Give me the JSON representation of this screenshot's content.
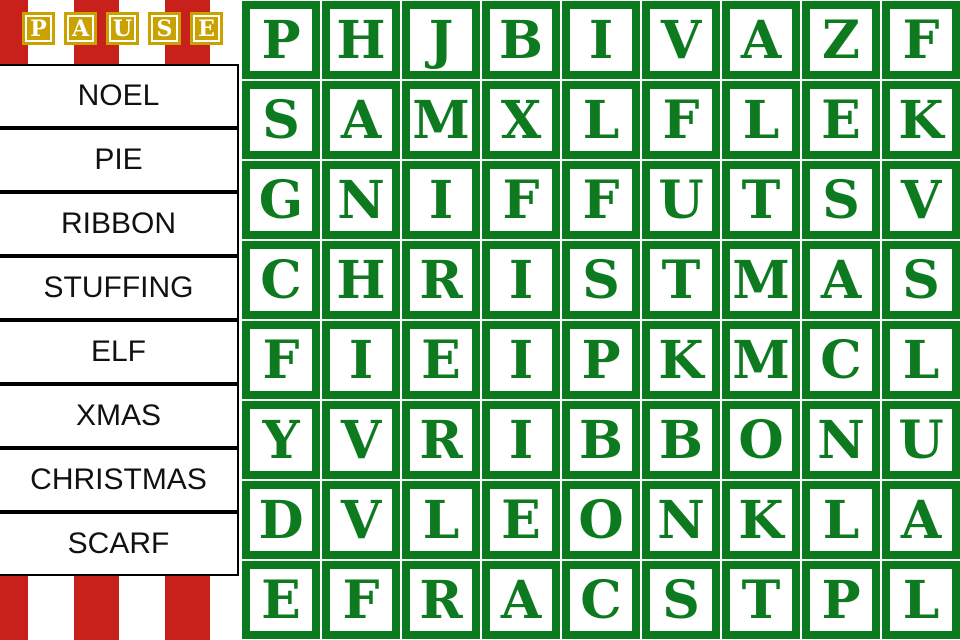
{
  "pause_label": [
    "P",
    "A",
    "U",
    "S",
    "E"
  ],
  "word_list": [
    "NOEL",
    "PIE",
    "RIBBON",
    "STUFFING",
    "ELF",
    "XMAS",
    "CHRISTMAS",
    "SCARF"
  ],
  "grid": [
    "PHJBIVAZF",
    "SAMXLFLEK",
    "GNIFFUTSV",
    "CHRISTMAS",
    "FIEIPKMCL",
    "YVRIBBONU",
    "DVLEONKLA",
    "EFRACSTPL"
  ],
  "colors": {
    "tile": "#0e7a1f",
    "pause": "#c9a100",
    "stripe": "#c8201a"
  }
}
